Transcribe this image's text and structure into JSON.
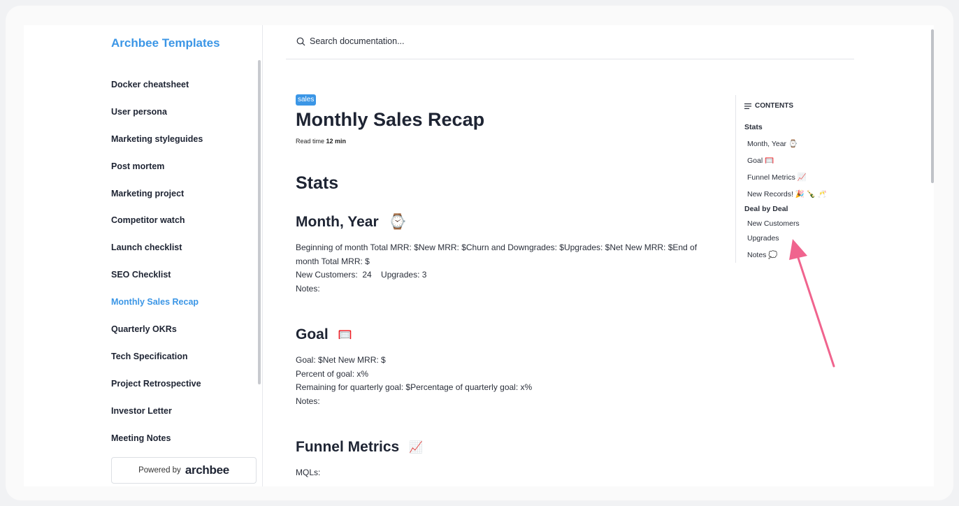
{
  "sidebar": {
    "brand": "Archbee Templates",
    "items": [
      {
        "label": "Docker cheatsheet"
      },
      {
        "label": "User persona"
      },
      {
        "label": "Marketing styleguides"
      },
      {
        "label": "Post mortem"
      },
      {
        "label": "Marketing project"
      },
      {
        "label": "Competitor watch"
      },
      {
        "label": "Launch checklist"
      },
      {
        "label": "SEO Checklist"
      },
      {
        "label": "Monthly Sales Recap",
        "active": true
      },
      {
        "label": "Quarterly OKRs"
      },
      {
        "label": "Tech Specification"
      },
      {
        "label": "Project Retrospective"
      },
      {
        "label": "Investor Letter"
      },
      {
        "label": "Meeting Notes"
      }
    ],
    "powered_prefix": "Powered by",
    "powered_logo": "archbee"
  },
  "search": {
    "placeholder": "Search documentation...",
    "icon": "search-icon"
  },
  "doc": {
    "tag": "sales",
    "title": "Monthly Sales Recap",
    "read_time_label": "Read time",
    "read_time_value": "12 min",
    "stats_heading": "Stats",
    "month_heading": "Month, Year",
    "month_emoji": "⌚",
    "month_lines": [
      "Beginning of month Total MRR: $New MRR: $Churn and Downgrades: $Upgrades: $Net New MRR: $End of month Total MRR: $",
      "New Customers:  24    Upgrades: 3",
      "Notes:"
    ],
    "goal_heading": "Goal",
    "goal_emoji": "🥅",
    "goal_lines": [
      "Goal: $Net New MRR: $",
      "Percent of goal: x%",
      "Remaining for quarterly goal: $Percentage of quarterly goal: x%",
      "Notes:"
    ],
    "funnel_heading": "Funnel Metrics",
    "funnel_emoji": "📈",
    "funnel_lines": [
      "MQLs:"
    ]
  },
  "toc": {
    "heading": "CONTENTS",
    "items": [
      {
        "label": "Stats",
        "level": 1
      },
      {
        "label": "Month, Year ⌚",
        "level": 2
      },
      {
        "label": "Goal 🥅",
        "level": 2
      },
      {
        "label": "Funnel Metrics 📈",
        "level": 2
      },
      {
        "label": "New Records! 🎉 🍾 🥂",
        "level": 2
      },
      {
        "label": "Deal by Deal",
        "level": 1
      },
      {
        "label": "New Customers",
        "level": 2
      },
      {
        "label": "Upgrades",
        "level": 2
      },
      {
        "label": "Notes 💭",
        "level": 2
      }
    ]
  },
  "colors": {
    "accent": "#3b96e6",
    "arrow": "#f0648e",
    "text": "#1e2433"
  }
}
